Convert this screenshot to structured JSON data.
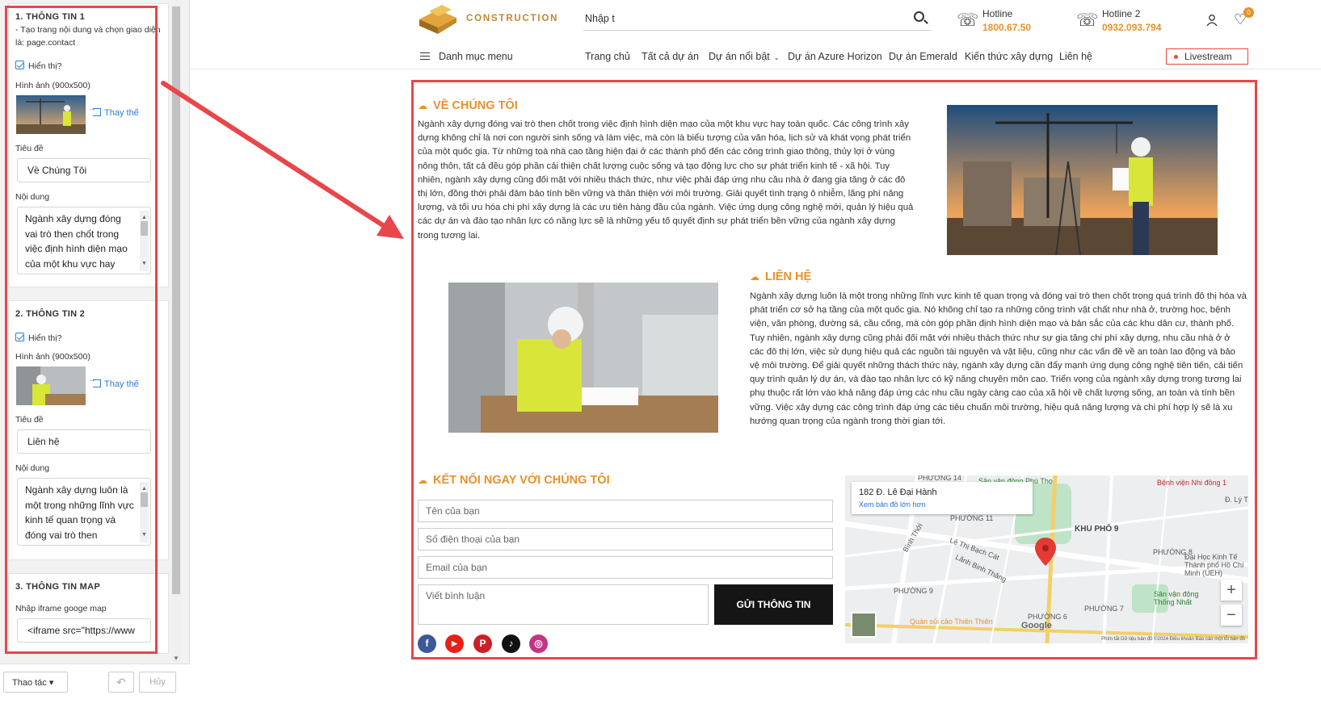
{
  "editor": {
    "sec1": {
      "title": "1. THÔNG TIN 1",
      "note": "- Tạo trang nội dung và chọn giao diện là: page.contact",
      "show_label": "Hiển thị?",
      "image_label": "Hình ảnh (900x500)",
      "replace_label": "Thay thế",
      "title_label": "Tiêu đề",
      "title_value": "Về Chúng Tôi",
      "content_label": "Nội dung",
      "content_value": "Ngành xây dựng đóng vai trò then chốt trong việc định hình diện mạo của một khu vực hay"
    },
    "sec2": {
      "title": "2. THÔNG TIN 2",
      "show_label": "Hiển thị?",
      "image_label": "Hình ảnh (900x500)",
      "replace_label": "Thay thế",
      "title_label": "Tiêu đề",
      "title_value": "Liên hệ",
      "content_label": "Nội dung",
      "content_value": "Ngành xây dựng luôn là một trong những lĩnh vực kinh tế quan trọng và đóng vai trò then"
    },
    "sec3": {
      "title": "3. THÔNG TIN MAP",
      "iframe_label": "Nhập iframe googe map",
      "iframe_value": "<iframe src=\"https://www"
    },
    "footer": {
      "actions_label": "Thao tác ▾",
      "cancel_label": "Hủy",
      "undo_icon": "undo-icon"
    }
  },
  "header": {
    "logo_text": "CONSTRUCTION",
    "search_placeholder": "Nhập t",
    "hotline1_label": "Hotline",
    "hotline1_value": "1800.67.50",
    "hotline2_label": "Hotline 2",
    "hotline2_value": "0932.093.794",
    "cart_count": "0",
    "menu_all": "Danh mục menu",
    "nav": [
      "Trang chủ",
      "Tất cả dự án",
      "Dự án nổi bật",
      "Dự án Azure Horizon",
      "Dự án Emerald",
      "Kiến thức xây dựng",
      "Liên hệ"
    ],
    "livestream": "Livestream"
  },
  "about": {
    "heading": "VỀ CHÚNG TÔI",
    "text": "Ngành xây dựng đóng vai trò then chốt trong việc định hình diện mạo của một khu vực hay toàn quốc. Các công trình xây dựng không chỉ là nơi con người sinh sống và làm việc, mà còn là biểu tượng của văn hóa, lịch sử và khát vọng phát triển của một quốc gia. Từ những toà nhà cao tầng hiện đại ở các thành phố đến các công trình giao thông, thủy lợi ở vùng nông thôn, tất cả đều góp phần cải thiện chất lượng cuộc sống và tạo động lực cho sự phát triển kinh tế - xã hội. Tuy nhiên, ngành xây dựng cũng đối mặt với nhiều thách thức, như việc phải đáp ứng nhu cầu nhà ở đang gia tăng ở các đô thị lớn, đồng thời phải đảm bảo tính bền vững và thân thiện với môi trường. Giải quyết tình trạng ô nhiễm, lãng phí năng lượng, và tối ưu hóa chi phí xây dựng là các ưu tiên hàng đầu của ngành. Việc ứng dụng công nghệ mới, quản lý hiệu quả các dự án và đào tạo nhân lực có năng lực sẽ là những yếu tố quyết định sự phát triển bền vững của ngành xây dựng trong tương lai."
  },
  "contact": {
    "heading": "LIÊN HỆ",
    "text": "Ngành xây dựng luôn là một trong những lĩnh vực kinh tế quan trọng và đóng vai trò then chốt trong quá trình đô thị hóa và phát triển cơ sở hạ tầng của một quốc gia. Nó không chỉ tạo ra những công trình vật chất như nhà ở, trường học, bệnh viện, văn phòng, đường sá, cầu cống, mà còn góp phần định hình diện mạo và bản sắc của các khu dân cư, thành phố. Tuy nhiên, ngành xây dựng cũng phải đối mặt với nhiều thách thức như sự gia tăng chi phí xây dựng, nhu cầu nhà ở ở các đô thị lớn, việc sử dụng hiệu quả các nguồn tài nguyên và vật liệu, cũng như các vấn đề về an toàn lao động và bảo vệ môi trường. Để giải quyết những thách thức này, ngành xây dựng cần đẩy mạnh ứng dụng công nghệ tiên tiến, cải tiến quy trình quản lý dự án, và đào tạo nhân lực có kỹ năng chuyên môn cao. Triển vọng của ngành xây dựng trong tương lai phụ thuộc rất lớn vào khả năng đáp ứng các nhu cầu ngày càng cao của xã hội về chất lượng sống, an toàn và tính bền vững. Việc xây dựng các công trình đáp ứng các tiêu chuẩn môi trường, hiệu quả năng lượng và chi phí hợp lý sẽ là xu hướng quan trọng của ngành trong thời gian tới."
  },
  "connect": {
    "heading": "KẾT NỐI NGAY VỚI CHÚNG TÔI",
    "name_ph": "Tên của bạn",
    "phone_ph": "Số điện thoại của bạn",
    "email_ph": "Email của bạn",
    "comment_ph": "Viết bình luận",
    "send_label": "GỬI THÔNG TIN"
  },
  "map": {
    "address": "182 Đ. Lê Đại Hành",
    "view_larger": "Xem bản đồ lớn hơn",
    "labels": [
      "PHƯỜNG 14",
      "Sân vận động Phú Thọ",
      "Bệnh viện Nhi đồng 1",
      "PHƯỜNG 11",
      "KHU PHỐ 9",
      "Bình Thới",
      "Lê Thị Bạch Cát",
      "Lãnh Binh Thăng",
      "PHƯỜNG 8",
      "Đại Học Kinh Tế Thành phố Hồ Chí Minh (UEH)",
      "PHƯỜNG 9",
      "Sân vận động Thống Nhất",
      "PHƯỜNG 7",
      "Quán sủi cảo Thiên Thiên",
      "PHƯỜNG 6",
      "Đ. Lý T"
    ],
    "footer": "Phím tắt   Dữ liệu bản đồ ©2024   Điều khoản   Báo cáo một lỗi bản đồ",
    "google": "Google"
  },
  "colors": {
    "accent": "#e8912a",
    "annotation": "#e8464a",
    "link": "#2a7fd4"
  }
}
